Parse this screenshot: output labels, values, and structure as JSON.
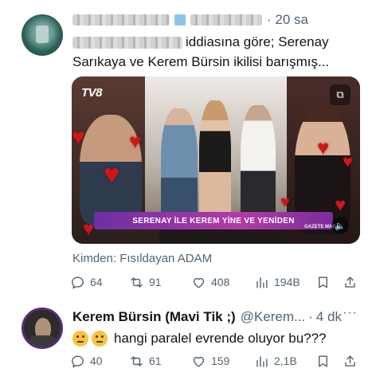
{
  "tweet1": {
    "header": {
      "time": "· 20 sa"
    },
    "body_line1": "iddiasına göre; Serenay",
    "body_line2": "Sarıkaya ve Kerem Bürsin ikilisi barışmış...",
    "media": {
      "channel_logo": "TV8",
      "banner": "SERENAY İLE KEREM YİNE VE YENİDEN",
      "watermark": "GAZETE MAG"
    },
    "source": "Kimden: Fısıldayan ADAM",
    "actions": {
      "replies": "64",
      "retweets": "91",
      "likes": "408",
      "views": "194B"
    }
  },
  "tweet2": {
    "name": "Kerem Bürsin (Mavi Tik ;)",
    "handle": "@Kerem...",
    "time": "4 dk",
    "more": "···",
    "text": "hangi paralel evrende oluyor bu???",
    "actions": {
      "replies": "40",
      "retweets": "61",
      "likes": "159",
      "views": "2,1B"
    }
  },
  "icons": {
    "reply": "reply-icon",
    "retweet": "retweet-icon",
    "like": "heart-icon",
    "views": "views-bar-chart-icon",
    "bookmark": "bookmark-icon",
    "share": "share-icon",
    "emoji": "thinking-face-emoji"
  },
  "colors": {
    "text": "#0f1419",
    "muted": "#536471",
    "banner": "#8a2fa8",
    "heart": "#d4141a"
  }
}
